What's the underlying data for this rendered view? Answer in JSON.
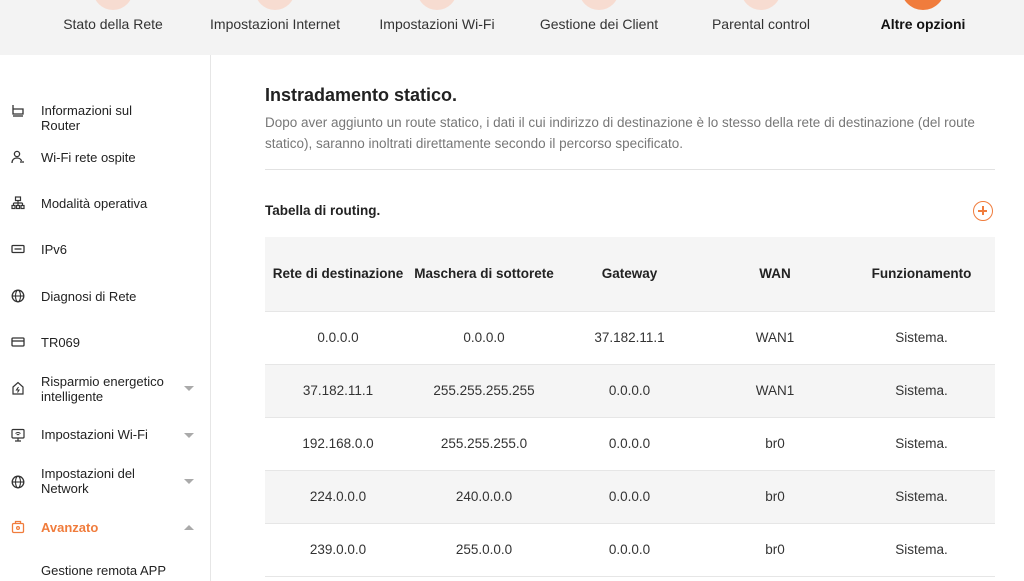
{
  "nav": {
    "tabs": [
      {
        "label": "Stato della Rete"
      },
      {
        "label": "Impostazioni Internet"
      },
      {
        "label": "Impostazioni Wi-Fi"
      },
      {
        "label": "Gestione dei Client"
      },
      {
        "label": "Parental control"
      },
      {
        "label": "Altre opzioni",
        "active": true
      }
    ]
  },
  "sidebar": {
    "items": [
      {
        "label": "Informazioni sul Router",
        "icon": "router-icon"
      },
      {
        "label": "Wi-Fi rete ospite",
        "icon": "guest-user-icon"
      },
      {
        "label": "Modalità operativa",
        "icon": "topology-icon"
      },
      {
        "label": "IPv6",
        "icon": "ipv6-icon"
      },
      {
        "label": "Diagnosi di Rete",
        "icon": "globe-icon"
      },
      {
        "label": "TR069",
        "icon": "tr069-icon"
      },
      {
        "label": "Risparmio energetico intelligente",
        "icon": "energy-icon",
        "expandable": true
      },
      {
        "label": "Impostazioni Wi-Fi",
        "icon": "wifi-settings-icon",
        "expandable": true
      },
      {
        "label": "Impostazioni del Network",
        "icon": "network-globe-icon",
        "expandable": true
      },
      {
        "label": "Avanzato",
        "icon": "advanced-icon",
        "expandable": true,
        "expanded": true,
        "active": true
      },
      {
        "label": "Gestione remota APP"
      }
    ]
  },
  "main": {
    "title": "Instradamento statico.",
    "description": "Dopo aver aggiunto un route statico, i dati il cui indirizzo di destinazione è lo stesso della rete di destinazione (del route statico), saranno inoltrati direttamente secondo il percorso specificato.",
    "section_title": "Tabella di routing.",
    "add_icon": "plus-circle-icon",
    "table": {
      "headers": [
        "Rete di destinazione",
        "Maschera di sottorete",
        "Gateway",
        "WAN",
        "Funzionamento"
      ],
      "rows": [
        [
          "0.0.0.0",
          "0.0.0.0",
          "37.182.11.1",
          "WAN1",
          "Sistema."
        ],
        [
          "37.182.11.1",
          "255.255.255.255",
          "0.0.0.0",
          "WAN1",
          "Sistema."
        ],
        [
          "192.168.0.0",
          "255.255.255.0",
          "0.0.0.0",
          "br0",
          "Sistema."
        ],
        [
          "224.0.0.0",
          "240.0.0.0",
          "0.0.0.0",
          "br0",
          "Sistema."
        ],
        [
          "239.0.0.0",
          "255.0.0.0",
          "0.0.0.0",
          "br0",
          "Sistema."
        ]
      ]
    }
  },
  "colors": {
    "accent": "#f07c3c",
    "tab_circle": "#f7dcd1",
    "header_bg": "#f3f3f3",
    "row_alt_bg": "#f5f5f5"
  }
}
